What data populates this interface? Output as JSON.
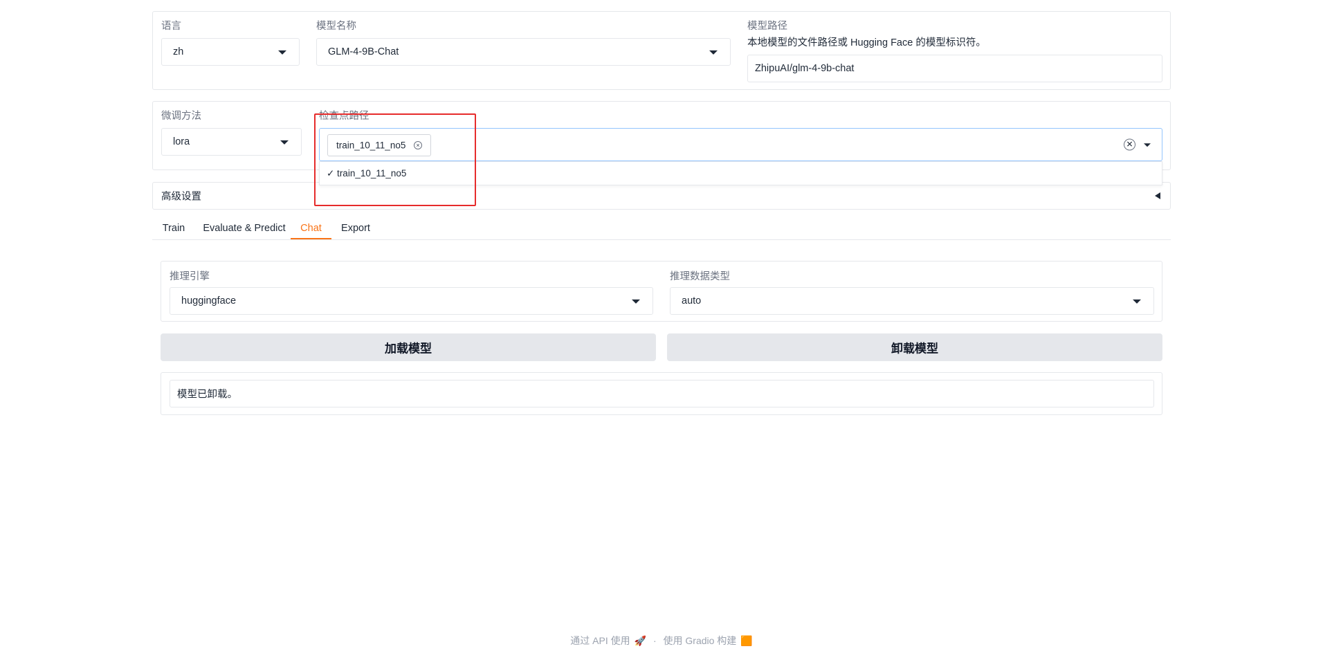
{
  "top_panel": {
    "lang_label": "语言",
    "lang_value": "zh",
    "model_name_label": "模型名称",
    "model_name_value": "GLM-4-9B-Chat",
    "model_path_label": "模型路径",
    "model_path_info": "本地模型的文件路径或 Hugging Face 的模型标识符。",
    "model_path_value": "ZhipuAI/glm-4-9b-chat"
  },
  "second_panel": {
    "finetune_label": "微调方法",
    "finetune_value": "lora",
    "checkpoint_label": "检查点路径",
    "checkpoint_chip": "train_10_11_no5",
    "chip_remove_glyph": "×",
    "clear_glyph": "✕",
    "dropdown_option": "✓ train_10_11_no5"
  },
  "advanced": {
    "title": "高级设置"
  },
  "tabs": [
    {
      "label": "Train"
    },
    {
      "label": "Evaluate & Predict"
    },
    {
      "label": "Chat",
      "active": true
    },
    {
      "label": "Export"
    }
  ],
  "chat": {
    "infer_engine_label": "推理引擎",
    "infer_engine_value": "huggingface",
    "infer_dtype_label": "推理数据类型",
    "infer_dtype_value": "auto",
    "load_button": "加载模型",
    "unload_button": "卸载模型",
    "status_text": "模型已卸载。"
  },
  "footer": {
    "api_text": "通过 API 使用",
    "api_icon": "🚀",
    "separator": "·",
    "built_text": "使用 Gradio 构建",
    "gradio_icon": "🟧"
  },
  "colors": {
    "accent": "#f97316",
    "highlight_box": "#e62b2b",
    "button_bg": "#e5e7eb"
  }
}
